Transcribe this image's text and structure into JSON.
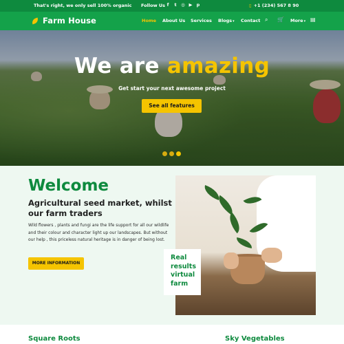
{
  "topbar": {
    "tagline": "That's right, we only sell 100% organic",
    "follow_label": "Follow Us",
    "socials": [
      {
        "icon": "facebook-icon",
        "glyph": "f"
      },
      {
        "icon": "twitter-icon",
        "glyph": "t"
      },
      {
        "icon": "instagram-icon",
        "glyph": "◎"
      },
      {
        "icon": "youtube-icon",
        "glyph": "▶"
      },
      {
        "icon": "pinterest-icon",
        "glyph": "p"
      }
    ],
    "phone": "+1 (234) 567 8 90"
  },
  "nav": {
    "brand": "Farm House",
    "items": [
      {
        "label": "Home",
        "active": true
      },
      {
        "label": "About Us"
      },
      {
        "label": "Services"
      },
      {
        "label": "Blogs",
        "dropdown": true
      },
      {
        "label": "Contact"
      }
    ],
    "more_label": "More",
    "icons": [
      "search-icon",
      "cart-icon",
      "menu-grid-icon"
    ]
  },
  "hero": {
    "title_plain": "We are ",
    "title_accent": "amazing",
    "subtitle": "Get start your next awesome project",
    "button_label": "See all features",
    "slide_count": 3,
    "active_slide": 3
  },
  "welcome": {
    "title": "Welcome",
    "subtitle": "Agricultural seed market, whilst our farm traders",
    "body": "Wild flowers , plants and fungi are the life support for all our wildlife and their colour and character light up our landscapes. But without our help , this priceless natural heritage is in danger of being lost.",
    "button_label": "MORE INFORMATION",
    "badge_lines": [
      "Real",
      "results",
      "virtual",
      "farm"
    ]
  },
  "bottom": {
    "left_title": "Square Roots",
    "right_title": "Sky Vegetables"
  },
  "colors": {
    "green_dark": "#0e8a3e",
    "green_nav": "#14a24a",
    "accent_yellow": "#f5c400",
    "section_bg": "#eef8f1"
  }
}
